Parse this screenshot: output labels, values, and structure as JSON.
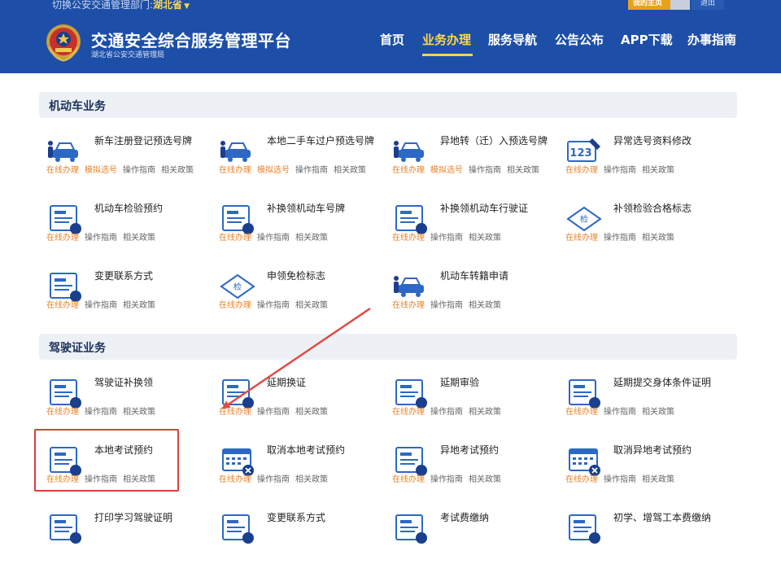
{
  "header": {
    "dept_prefix": "切换公安交通管理部门:",
    "dept_value": "湖北省",
    "my_home": "我的主页",
    "logout": "退出",
    "site_title": "交通安全综合服务管理平台",
    "site_subtitle": "湖北省公安交通管理局",
    "nav": [
      "首页",
      "业务办理",
      "服务导航",
      "公告公布",
      "APP下载",
      "办事指南"
    ],
    "active_nav": "业务办理"
  },
  "colors": {
    "header_bg": "#1d4fa8",
    "accent_yellow": "#ffd54a",
    "online_orange": "#e8822a",
    "highlight_red": "#d9403a",
    "icon_blue": "#2d68c4"
  },
  "sections": [
    {
      "title": "机动车业务",
      "items": [
        {
          "name": "新车注册登记预选号牌",
          "icon": "new-car-plate-icon",
          "links": [
            "在线办理",
            "模拟选号",
            "操作指南",
            "相关政策"
          ]
        },
        {
          "name": "本地二手车过户预选号牌",
          "icon": "used-car-transfer-icon",
          "links": [
            "在线办理",
            "模拟选号",
            "操作指南",
            "相关政策"
          ]
        },
        {
          "name": "异地转（迁）入预选号牌",
          "icon": "car-transfer-in-icon",
          "links": [
            "在线办理",
            "模拟选号",
            "操作指南",
            "相关政策"
          ]
        },
        {
          "name": "异常选号资料修改",
          "icon": "plate-123-edit-icon",
          "links": [
            "在线办理",
            "操作指南",
            "相关政策"
          ]
        },
        {
          "name": "机动车检验预约",
          "icon": "inspection-appointment-icon",
          "links": [
            "在线办理",
            "操作指南",
            "相关政策"
          ]
        },
        {
          "name": "补换领机动车号牌",
          "icon": "plate-replace-icon",
          "links": [
            "在线办理",
            "操作指南",
            "相关政策"
          ]
        },
        {
          "name": "补换领机动车行驶证",
          "icon": "driving-permit-replace-icon",
          "links": [
            "在线办理",
            "操作指南",
            "相关政策"
          ]
        },
        {
          "name": "补领检验合格标志",
          "icon": "inspection-mark-icon",
          "links": [
            "在线办理",
            "操作指南",
            "相关政策"
          ]
        },
        {
          "name": "变更联系方式",
          "icon": "contact-change-icon",
          "links": [
            "在线办理",
            "操作指南",
            "相关政策"
          ]
        },
        {
          "name": "申领免检标志",
          "icon": "exemption-mark-icon",
          "links": [
            "在线办理",
            "操作指南",
            "相关政策"
          ]
        },
        {
          "name": "机动车转籍申请",
          "icon": "vehicle-transfer-icon",
          "links": [
            "在线办理",
            "操作指南",
            "相关政策"
          ]
        }
      ]
    },
    {
      "title": "驾驶证业务",
      "items": [
        {
          "name": "驾驶证补换领",
          "icon": "license-replace-icon",
          "links": [
            "在线办理",
            "操作指南",
            "相关政策"
          ]
        },
        {
          "name": "延期换证",
          "icon": "license-defer-icon",
          "links": [
            "在线办理",
            "操作指南",
            "相关政策"
          ]
        },
        {
          "name": "延期审验",
          "icon": "review-defer-icon",
          "links": [
            "在线办理",
            "操作指南",
            "相关政策"
          ]
        },
        {
          "name": "延期提交身体条件证明",
          "icon": "health-cert-defer-icon",
          "links": [
            "在线办理",
            "操作指南",
            "相关政策"
          ]
        },
        {
          "name": "本地考试预约",
          "icon": "local-exam-appointment-icon",
          "links": [
            "在线办理",
            "操作指南",
            "相关政策"
          ]
        },
        {
          "name": "取消本地考试预约",
          "icon": "cancel-local-exam-icon",
          "links": [
            "在线办理",
            "操作指南",
            "相关政策"
          ]
        },
        {
          "name": "异地考试预约",
          "icon": "remote-exam-appointment-icon",
          "links": [
            "在线办理",
            "操作指南",
            "相关政策"
          ]
        },
        {
          "name": "取消异地考试预约",
          "icon": "cancel-remote-exam-icon",
          "links": [
            "在线办理",
            "操作指南",
            "相关政策"
          ]
        },
        {
          "name": "打印学习驾驶证明",
          "icon": "print-learner-cert-icon",
          "links": []
        },
        {
          "name": "变更联系方式",
          "icon": "license-contact-change-icon",
          "links": []
        },
        {
          "name": "考试费缴纳",
          "icon": "exam-fee-icon",
          "links": []
        },
        {
          "name": "初学、增驾工本费缴纳",
          "icon": "license-fee-icon",
          "links": []
        }
      ]
    }
  ]
}
